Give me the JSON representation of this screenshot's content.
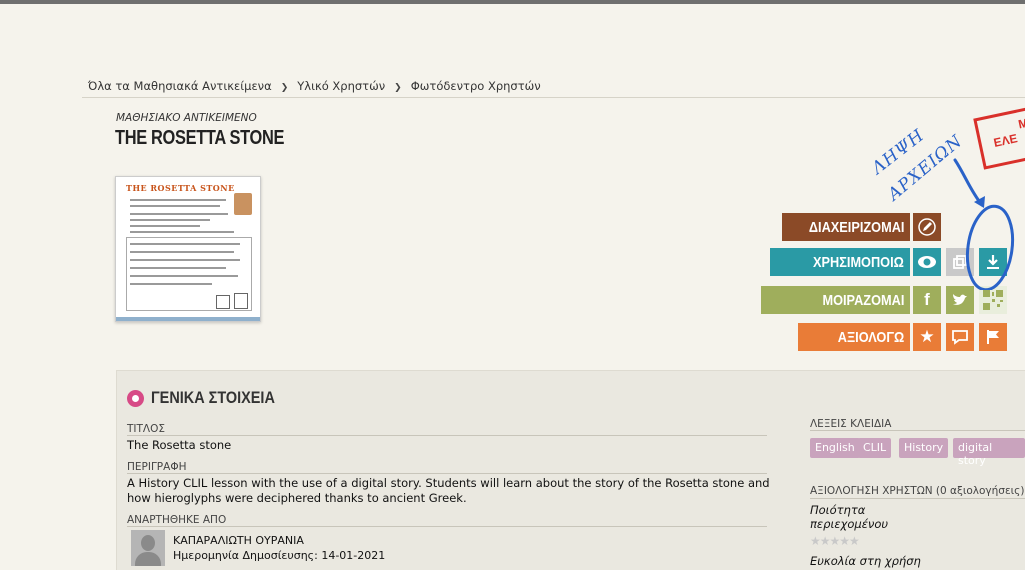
{
  "breadcrumb": {
    "items": [
      "Όλα τα Μαθησιακά Αντικείμενα",
      "Υλικό Χρηστών",
      "Φωτόδεντρο Χρηστών"
    ],
    "separator": "❯"
  },
  "object": {
    "kicker": "ΜΑΘΗΣΙΑΚΟ ΑΝΤΙΚΕΙΜΕΝΟ",
    "title": "THE ROSETTA STONE",
    "thumbnail_title": "THE ROSETTA STONE"
  },
  "actions": {
    "manage_label": "ΔΙΑΧΕΙΡΙΖΟΜΑΙ",
    "use_label": "ΧΡΗΣΙΜΟΠΟΙΩ",
    "share_label": "ΜΟΙΡΑΖΟΜΑΙ",
    "rate_label": "ΑΞΙΟΛΟΓΩ",
    "icons": {
      "edit": "pencil-icon",
      "view": "eye-icon",
      "embed": "copy-icon",
      "download": "download-icon",
      "facebook": "facebook-icon",
      "twitter": "twitter-icon",
      "qr": "qr-code-icon",
      "favorite": "star-icon",
      "comment": "comment-icon",
      "report": "flag-icon"
    },
    "colors": {
      "manage": "#8b4a27",
      "use": "#2a9aa5",
      "share": "#9fae5c",
      "rate": "#e97c37"
    }
  },
  "annotation": {
    "line1": "ΛΗΨΗ",
    "line2": "ΑΡΧΕΙΩΝ",
    "stamp_line1": "Μ",
    "stamp_line2": "ΕΛΕ"
  },
  "general": {
    "heading": "ΓΕΝΙΚΑ ΣΤΟΙΧΕΙΑ",
    "title_label": "ΤΙΤΛΟΣ",
    "title_value": "The Rosetta stone",
    "description_label": "ΠΕΡΙΓΡΑΦΗ",
    "description_value": "A History CLIL lesson with the use of a digital story. Students will learn about the story of the Rosetta stone and how hieroglyphs were deciphered thanks to ancient Greek.",
    "posted_by_label": "ΑΝΑΡΤΗΘΗΚΕ ΑΠΟ",
    "author": "ΚΑΠΑΡΑΛΙΩΤΗ ΟΥΡΑΝΙΑ",
    "publication_date": "Ημερομηνία Δημοσίευσης: 14-01-2021"
  },
  "sidebar": {
    "keywords_label": "ΛΕΞΕΙΣ ΚΛΕΙΔΙΑ",
    "keywords": [
      "English",
      "CLIL",
      "History",
      "digital story"
    ],
    "ratings_label": "ΑΞΙΟΛΟΓΗΣΗ ΧΡΗΣΤΩΝ (0 αξιολογήσεις)",
    "quality_label": "Ποιότητα περιεχομένου",
    "ease_label": "Ευκολία στη χρήση",
    "stars": "★★★★★"
  }
}
